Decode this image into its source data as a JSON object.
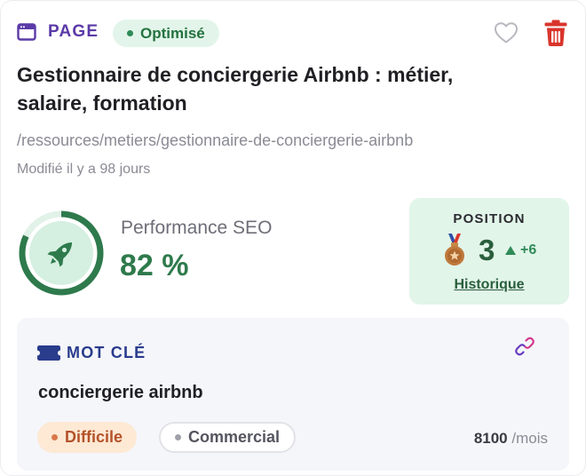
{
  "header": {
    "type_label": "PAGE",
    "status": "Optimisé",
    "type_icon": "browser-window-icon",
    "favorite_icon": "heart-outline-icon",
    "delete_icon": "trash-icon"
  },
  "page": {
    "title": "Gestionnaire de conciergerie Airbnb : métier, salaire, formation",
    "url": "/ressources/metiers/gestionnaire-de-conciergerie-airbnb",
    "modified": "Modifié il y a 98 jours"
  },
  "performance": {
    "label": "Performance SEO",
    "value_text": "82 %",
    "fraction": 0.82,
    "icon": "rocket-icon"
  },
  "position": {
    "label": "POSITION",
    "value": "3",
    "delta": "+6",
    "trend": "up",
    "history_label": "Historique",
    "medal_icon": "bronze-medal-icon"
  },
  "keyword": {
    "label": "MOT CLÉ",
    "text": "conciergerie airbnb",
    "difficulty": "Difficile",
    "intent": "Commercial",
    "volume": "8100",
    "volume_unit": "/mois",
    "icon": "ticket-icon",
    "link_icon": "link-icon"
  },
  "colors": {
    "brand_purple": "#5b3aa8",
    "success_green": "#2e8b57",
    "danger_red": "#d9352c",
    "keyword_blue": "#2a3c8c",
    "difficulty_orange": "#b4522a"
  }
}
